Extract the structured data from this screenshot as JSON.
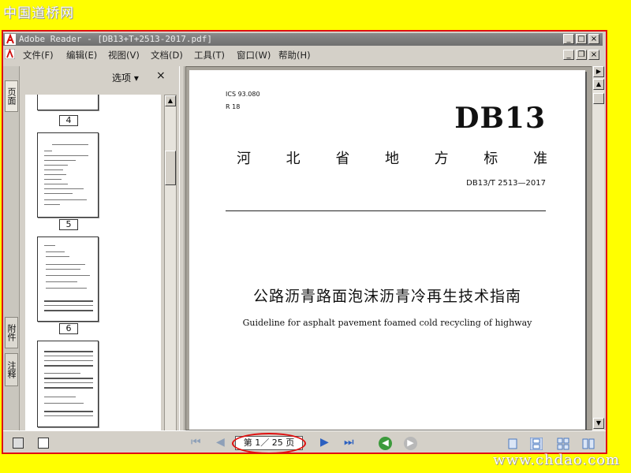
{
  "site": {
    "logo_text": "中国道桥网",
    "watermark": "www.chdao.com"
  },
  "window": {
    "title": "Adobe Reader - [DB13+T+2513-2017.pdf]",
    "minimize": "_",
    "maximize": "□",
    "close": "×",
    "restore": "❐"
  },
  "menu": {
    "items": [
      "文件(F)",
      "编辑(E)",
      "视图(V)",
      "文档(D)",
      "工具(T)",
      "窗口(W)",
      "帮助(H)"
    ]
  },
  "sidebar": {
    "tabs": [
      "页面",
      "附件",
      "注释"
    ],
    "options_label": "选项 ▾",
    "close_label": "×",
    "thumbnail_labels": [
      "4",
      "5",
      "6"
    ]
  },
  "document": {
    "ics": "ICS 93.080",
    "r_code": "R 18",
    "brand": "DB13",
    "standard_type_chars": [
      "河",
      "北",
      "省",
      "地",
      "方",
      "标",
      "准"
    ],
    "standard_number": "DB13/T 2513—2017",
    "chinese_title": "公路沥青路面泡沫沥青冷再生技术指南",
    "english_title": "Guideline for asphalt pavement foamed cold recycling of highway"
  },
  "statusbar": {
    "page_indicator": "第 1／ 25 页",
    "nav_first": "⏮",
    "nav_prev": "◀",
    "nav_next": "▶",
    "nav_last": "⏭",
    "history_back": "◀",
    "history_forward": "▶"
  },
  "colors": {
    "highlight_red": "#e01010",
    "background_yellow": "#ffff00",
    "title_bar": "#7a7a7a"
  }
}
